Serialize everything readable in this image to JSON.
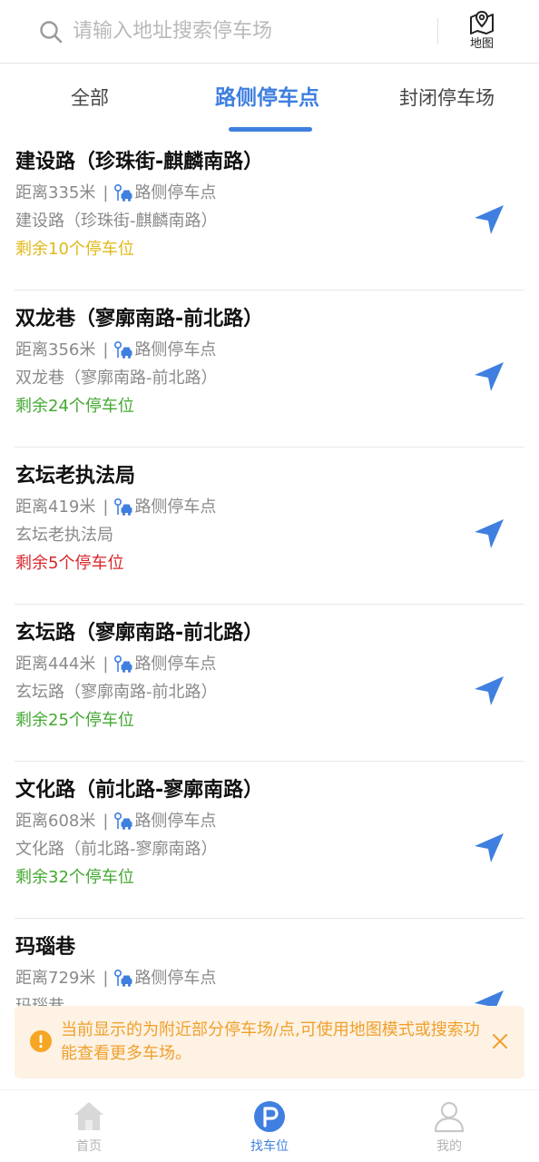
{
  "search": {
    "placeholder": "请输入地址搜索停车场",
    "map_label": "地图"
  },
  "tabs": [
    {
      "label": "全部",
      "active": false
    },
    {
      "label": "路侧停车点",
      "active": true
    },
    {
      "label": "封闭停车场",
      "active": false
    }
  ],
  "colors": {
    "accent": "#3f7fe0",
    "remain_yellow": "#e2b818",
    "remain_green": "#44a832",
    "remain_red": "#d9262b",
    "notice_text": "#f0a02c"
  },
  "items": [
    {
      "title": "建设路（珍珠街-麒麟南路）",
      "distance": "距离335米",
      "type": "路侧停车点",
      "address": "建设路（珍珠街-麒麟南路）",
      "remain": "剩余10个停车位",
      "remain_color": "#e2b818"
    },
    {
      "title": "双龙巷（寥廓南路-前北路）",
      "distance": "距离356米",
      "type": "路侧停车点",
      "address": "双龙巷（寥廓南路-前北路）",
      "remain": "剩余24个停车位",
      "remain_color": "#44a832"
    },
    {
      "title": "玄坛老执法局",
      "distance": "距离419米",
      "type": "路侧停车点",
      "address": "玄坛老执法局",
      "remain": "剩余5个停车位",
      "remain_color": "#d9262b"
    },
    {
      "title": "玄坛路（寥廓南路-前北路）",
      "distance": "距离444米",
      "type": "路侧停车点",
      "address": "玄坛路（寥廓南路-前北路）",
      "remain": "剩余25个停车位",
      "remain_color": "#44a832"
    },
    {
      "title": "文化路（前北路-寥廓南路）",
      "distance": "距离608米",
      "type": "路侧停车点",
      "address": "文化路（前北路-寥廓南路）",
      "remain": "剩余32个停车位",
      "remain_color": "#44a832"
    },
    {
      "title": "玛瑙巷",
      "distance": "距离729米",
      "type": "路侧停车点",
      "address": "玛瑙巷",
      "remain": "",
      "remain_color": "#44a832"
    }
  ],
  "notice": {
    "text": "当前显示的为附近部分停车场/点,可使用地图模式或搜索功能查看更多车场。"
  },
  "bottom_nav": [
    {
      "label": "首页",
      "active": false,
      "icon": "home-icon"
    },
    {
      "label": "找车位",
      "active": true,
      "icon": "parking-icon"
    },
    {
      "label": "我的",
      "active": false,
      "icon": "user-icon"
    }
  ]
}
